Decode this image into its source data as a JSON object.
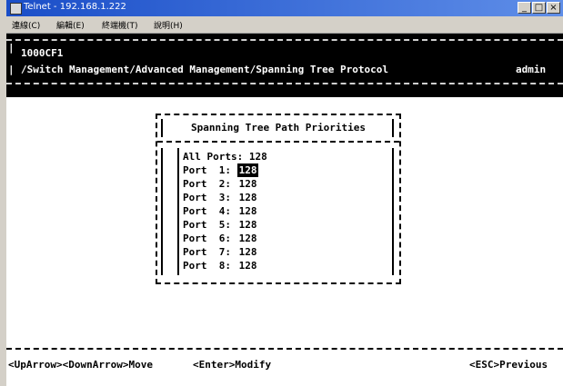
{
  "window": {
    "title": "Telnet - 192.168.1.222",
    "buttons": {
      "minimize": "_",
      "maximize": "□",
      "close": "×"
    }
  },
  "menu": [
    "連線(C)",
    "編輯(E)",
    "終端機(T)",
    "說明(H)"
  ],
  "header": {
    "device": "1000CF1",
    "path": "/Switch Management/Advanced Management/Spanning Tree Protocol",
    "user": "admin"
  },
  "panel": {
    "title": "Spanning Tree Path Priorities",
    "all_ports": "All Ports: 128",
    "ports": [
      {
        "label": "Port  1:",
        "value": "128",
        "selected": true
      },
      {
        "label": "Port  2:",
        "value": "128"
      },
      {
        "label": "Port  3:",
        "value": "128"
      },
      {
        "label": "Port  4:",
        "value": "128"
      },
      {
        "label": "Port  5:",
        "value": "128"
      },
      {
        "label": "Port  6:",
        "value": "128"
      },
      {
        "label": "Port  7:",
        "value": "128"
      },
      {
        "label": "Port  8:",
        "value": "128"
      }
    ]
  },
  "footer": {
    "move": "<UpArrow><DownArrow>Move",
    "modify": "<Enter>Modify",
    "previous": "<ESC>Previous"
  }
}
